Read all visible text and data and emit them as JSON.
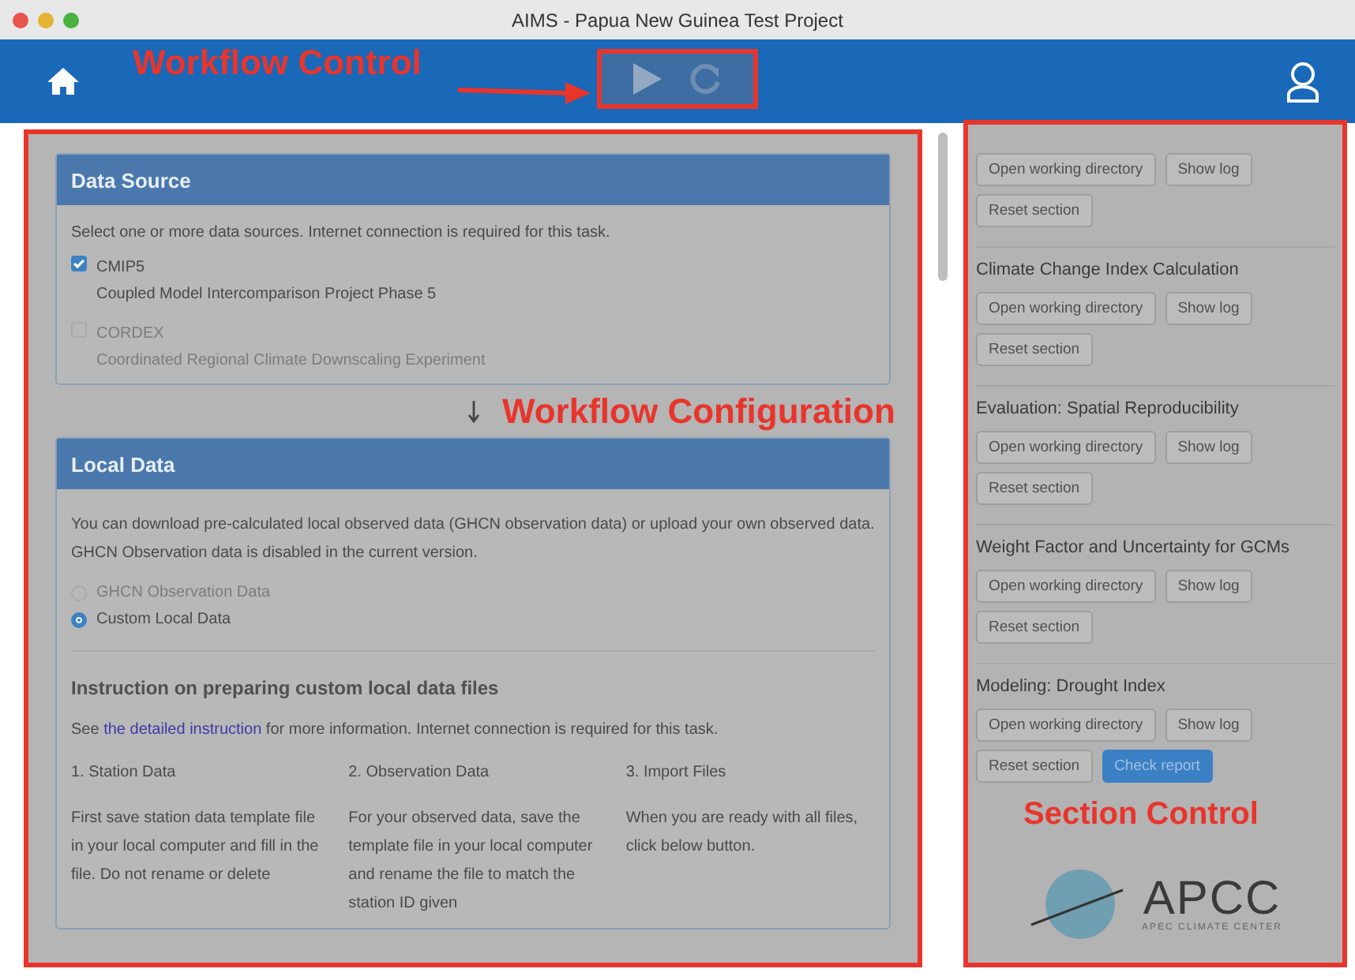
{
  "window": {
    "title": "AIMS - Papua New Guinea Test Project"
  },
  "annotations": [
    {
      "kind": "callout",
      "text": "Workflow Control"
    },
    {
      "kind": "panel",
      "text": "Workflow Configuration"
    },
    {
      "kind": "panel",
      "text": "Section Control"
    }
  ],
  "configuration": {
    "data_source": {
      "title": "Data Source",
      "description": "Select one or more data sources. Internet connection is required for this task.",
      "options": [
        {
          "label": "CMIP5",
          "detail": "Coupled Model Intercomparison Project Phase 5",
          "checked": true,
          "disabled": false
        },
        {
          "label": "CORDEX",
          "detail": "Coordinated Regional Climate Downscaling Experiment",
          "checked": false,
          "disabled": true
        }
      ]
    },
    "local_data": {
      "title": "Local Data",
      "description": "You can download pre-calculated local observed data (GHCN observation data) or upload your own observed data. GHCN Observation data is disabled in the current version.",
      "options": [
        {
          "label": "GHCN Observation Data",
          "selected": false,
          "disabled": true
        },
        {
          "label": "Custom Local Data",
          "selected": true,
          "disabled": false
        }
      ],
      "instruction_title": "Instruction on preparing custom local data files",
      "instruction_text": {
        "before": "See ",
        "link": "the detailed instruction",
        "after": " for more information. Internet connection is required for this task."
      },
      "steps": [
        {
          "title": "1. Station Data",
          "text": "First save station data template file in your local computer and fill in the file. Do not rename or delete"
        },
        {
          "title": "2. Observation Data",
          "text": "For your observed data, save the template file in your local computer and rename the file to match the station ID given"
        },
        {
          "title": "3. Import Files",
          "text": "When you are ready with all files, click below button."
        }
      ]
    }
  },
  "sections": [
    {
      "buttons": [
        {
          "label": "Open working directory",
          "kind": "default"
        },
        {
          "label": "Show log",
          "kind": "default"
        },
        {
          "label": "Reset section",
          "kind": "default"
        }
      ]
    },
    {
      "title": "Climate Change Index Calculation",
      "buttons": [
        {
          "label": "Open working directory",
          "kind": "default"
        },
        {
          "label": "Show log",
          "kind": "default"
        },
        {
          "label": "Reset section",
          "kind": "default"
        }
      ]
    },
    {
      "title": "Evaluation: Spatial Reproducibility",
      "buttons": [
        {
          "label": "Open working directory",
          "kind": "default"
        },
        {
          "label": "Show log",
          "kind": "default"
        },
        {
          "label": "Reset section",
          "kind": "default"
        }
      ]
    },
    {
      "title": "Weight Factor and Uncertainty for GCMs",
      "buttons": [
        {
          "label": "Open working directory",
          "kind": "default"
        },
        {
          "label": "Show log",
          "kind": "default"
        },
        {
          "label": "Reset section",
          "kind": "default"
        }
      ]
    },
    {
      "title": "Modeling: Drought Index",
      "buttons": [
        {
          "label": "Open working directory",
          "kind": "default"
        },
        {
          "label": "Show log",
          "kind": "default"
        },
        {
          "label": "Reset section",
          "kind": "default"
        },
        {
          "label": "Check report",
          "kind": "primary"
        }
      ]
    }
  ],
  "logo": {
    "name": "APCC",
    "subtitle": "APEC CLIMATE CENTER"
  }
}
